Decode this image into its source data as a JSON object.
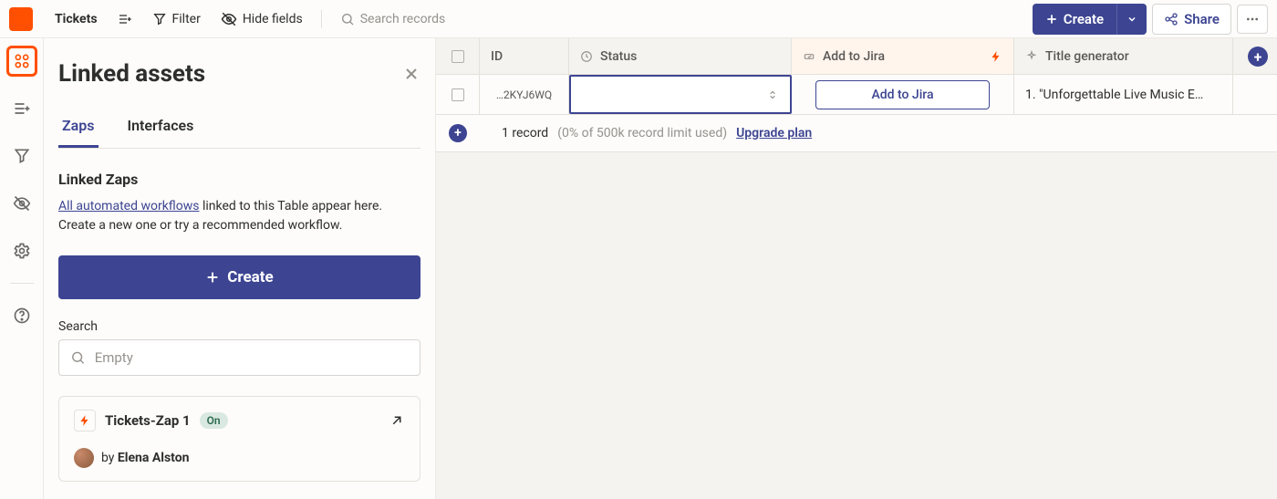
{
  "topbar": {
    "tab_name": "Tickets",
    "filter_label": "Filter",
    "hide_fields_label": "Hide fields",
    "search_placeholder": "Search records",
    "create_label": "Create",
    "share_label": "Share"
  },
  "panel": {
    "title": "Linked assets",
    "tabs": {
      "zaps": "Zaps",
      "interfaces": "Interfaces"
    },
    "section_heading": "Linked Zaps",
    "link_text": "All automated workflows",
    "desc_tail": " linked to this Table appear here. Create a new one or try a recommended workflow.",
    "create_label": "Create",
    "search_label": "Search",
    "search_placeholder": "Empty",
    "card": {
      "title": "Tickets-Zap 1",
      "badge": "On",
      "author_prefix": "by ",
      "author_name": "Elena Alston"
    }
  },
  "table": {
    "columns": {
      "id": "ID",
      "status": "Status",
      "add_to_jira": "Add to Jira",
      "title_gen": "Title generator"
    },
    "row": {
      "id": "…2KYJ6WQ",
      "jira_button": "Add to Jira",
      "title_value": "1. \"Unforgettable Live Music E…"
    },
    "footer": {
      "count": "1 record",
      "limit_note": "(0% of 500k record limit used)",
      "upgrade": "Upgrade plan"
    }
  }
}
